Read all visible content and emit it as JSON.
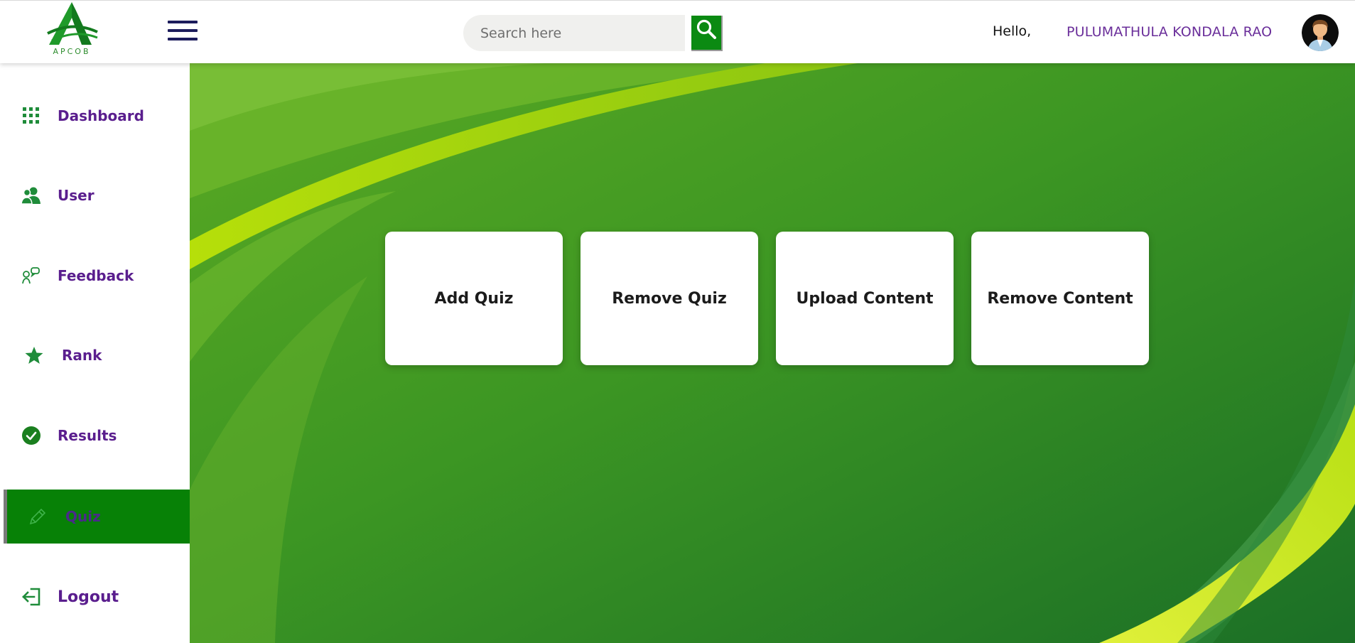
{
  "header": {
    "logo_text": "APCOB",
    "search_placeholder": "Search here",
    "greeting": "Hello,",
    "user_name": "PULUMATHULA KONDALA RAO"
  },
  "sidebar": {
    "items": [
      {
        "label": "Dashboard",
        "icon": "grid-icon"
      },
      {
        "label": "User",
        "icon": "users-icon"
      },
      {
        "label": "Feedback",
        "icon": "chat-bubbles-icon"
      },
      {
        "label": "Rank",
        "icon": "star-icon"
      },
      {
        "label": "Results",
        "icon": "check-circle-icon"
      },
      {
        "label": "Quiz",
        "icon": "pencil-icon",
        "active": true
      },
      {
        "label": "Logout",
        "icon": "logout-icon"
      }
    ]
  },
  "main": {
    "cards": [
      {
        "label": "Add Quiz"
      },
      {
        "label": "Remove Quiz"
      },
      {
        "label": "Upload Content"
      },
      {
        "label": "Remove Content"
      }
    ]
  },
  "colors": {
    "brand_green": "#078106",
    "nav_text_purple": "#5a1e8e",
    "username_purple": "#6a2e9a",
    "hamburger_navy": "#1c1c5c"
  }
}
